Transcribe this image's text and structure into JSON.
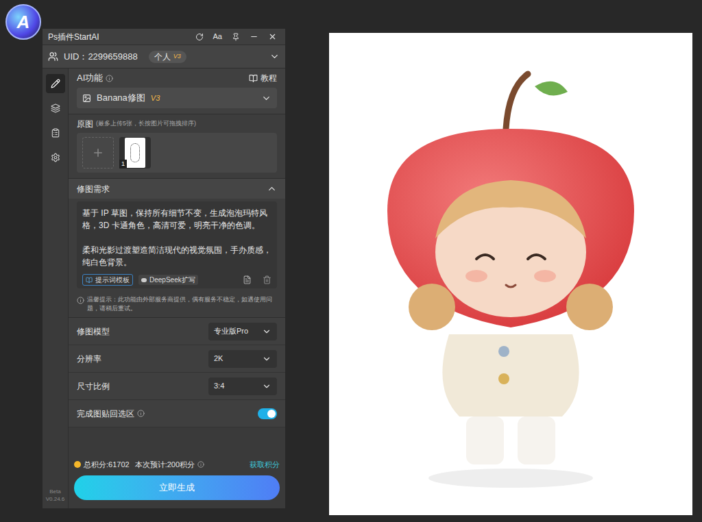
{
  "logo": {
    "text": "A"
  },
  "window": {
    "title": "Ps插件StartAI",
    "font_button": "Aa"
  },
  "account": {
    "uid": "UID：2299659888",
    "plan": "个人",
    "plan_badge": "V3"
  },
  "sidebar": {
    "items": [
      {
        "selected": true
      },
      {
        "selected": false
      },
      {
        "selected": false
      },
      {
        "selected": false
      }
    ],
    "version": [
      "Beta",
      "V0.24.6"
    ]
  },
  "ai_function": {
    "label": "AI功能",
    "help": "教程",
    "selected": "Banana修图",
    "selected_badge": "V3"
  },
  "source": {
    "label": "原图",
    "hint": "(最多上传5张，长按图片可拖拽排序)",
    "images": [
      {
        "index": "1"
      }
    ]
  },
  "prompt": {
    "label": "修图需求",
    "expanded": true,
    "paragraphs": [
      "基于 IP 草图，保持所有细节不变，生成泡泡玛特风格，3D 卡通角色，高清可爱，明亮干净的色调。",
      "柔和光影过渡塑造简洁现代的视觉氛围，手办质感，纯白色背景。"
    ],
    "buttons": [
      "提示词模板",
      "DeepSeek扩写"
    ]
  },
  "notice": "温馨提示：此功能由外部服务商提供，偶有服务不稳定，如遇使用问题，请稍后重试。",
  "settings": [
    {
      "label": "修图模型",
      "kind": "select",
      "value": "专业版Pro"
    },
    {
      "label": "分辨率",
      "kind": "select",
      "value": "2K"
    },
    {
      "label": "尺寸比例",
      "kind": "select",
      "value": "3:4"
    },
    {
      "label": "完成图贴回选区",
      "kind": "toggle",
      "on": true
    }
  ],
  "footer": {
    "total": "总积分:61702",
    "estimate": "本次预计:200积分",
    "get": "获取积分",
    "generate": "立即生成"
  }
}
